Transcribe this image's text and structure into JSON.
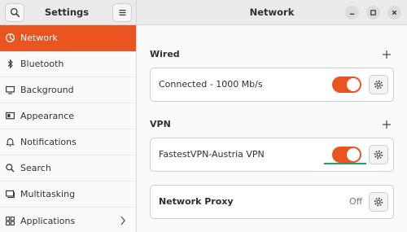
{
  "header": {
    "sidebar_title": "Settings",
    "main_title": "Network",
    "icons": {
      "search": "search-icon",
      "menu": "hamburger-menu-icon",
      "minimize": "minimize-icon",
      "maximize": "maximize-icon",
      "close": "close-icon"
    }
  },
  "sidebar": {
    "items": [
      {
        "label": "Network",
        "icon": "network-icon",
        "active": true
      },
      {
        "label": "Bluetooth",
        "icon": "bluetooth-icon"
      },
      {
        "label": "Background",
        "icon": "background-icon"
      },
      {
        "label": "Appearance",
        "icon": "appearance-icon"
      },
      {
        "label": "Notifications",
        "icon": "bell-icon"
      },
      {
        "label": "Search",
        "icon": "search-icon"
      },
      {
        "label": "Multitasking",
        "icon": "multitasking-icon"
      },
      {
        "label": "Applications",
        "icon": "applications-icon"
      }
    ]
  },
  "main": {
    "wired": {
      "title": "Wired",
      "connection_label": "Connected - 1000 Mb/s",
      "toggle_on": true
    },
    "vpn": {
      "title": "VPN",
      "connection_label": "FastestVPN-Austria VPN",
      "toggle_on": true
    },
    "proxy": {
      "label": "Network Proxy",
      "status": "Off"
    }
  },
  "colors": {
    "accent": "#e95420",
    "highlight_underline": "#26a269"
  }
}
